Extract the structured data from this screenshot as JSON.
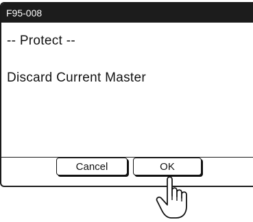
{
  "dialog": {
    "code": "F95-008",
    "heading": "-- Protect --",
    "message": "Discard Current Master"
  },
  "buttons": {
    "cancel_label": "Cancel",
    "ok_label": "OK"
  },
  "icons": {
    "pointer": "hand-pointer-icon"
  },
  "colors": {
    "titlebar": "#1c1c1c",
    "background": "#ffffff",
    "text": "#111111"
  }
}
